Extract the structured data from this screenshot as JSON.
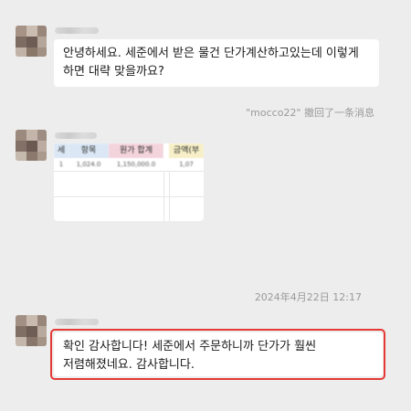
{
  "messages": [
    {
      "text": "안녕하세요. 세준에서 받은 물건 단가계산하고있는데 이렇게 하면 대략 맞을까요?"
    },
    {
      "system": "\"mocco22\" 撤回了一条消息"
    },
    {
      "sheet": {
        "headers": [
          "세",
          "항목",
          "원가 합계",
          "",
          "금액(부"
        ],
        "row": [
          "1",
          "1,024.0",
          "1,150,000.0",
          "",
          "1,07"
        ]
      }
    },
    {
      "timestamp": "2024年4月22日 12:17"
    },
    {
      "text": "확인 감사합니다! 세준에서 주문하니까 단가가 훨씬 저렴해졌네요. 감사합니다."
    }
  ],
  "colors": {
    "chat_background": "#ededed",
    "bubble": "#ffffff",
    "highlight_border": "#e53935",
    "sheet_header_blue": "#dbe7f5",
    "sheet_header_pink": "#f3d4dc",
    "sheet_header_yellow": "#f6efc7"
  }
}
